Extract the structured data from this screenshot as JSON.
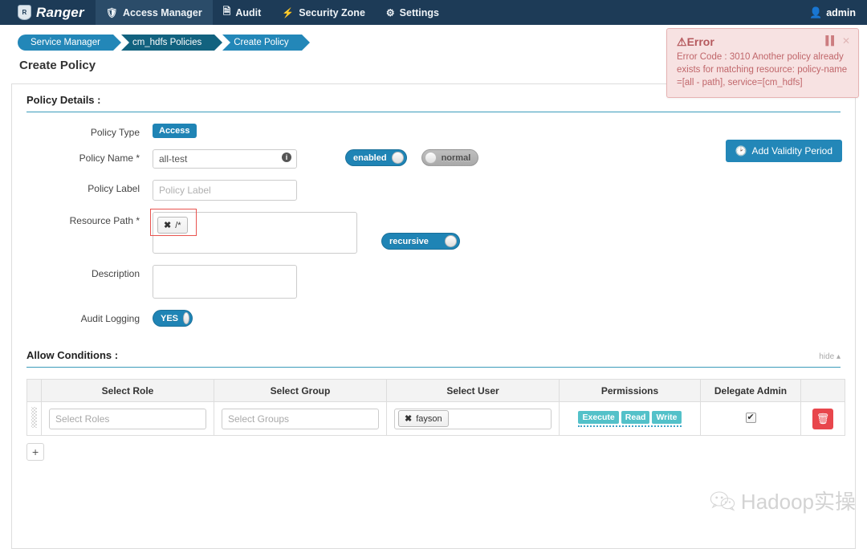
{
  "topnav": {
    "brand": "Ranger",
    "brand_badge": "R",
    "items": [
      {
        "label": "Access Manager",
        "icon": "shield-icon",
        "glyph": "⛨",
        "active": true
      },
      {
        "label": "Audit",
        "icon": "file-icon",
        "glyph": "὜E",
        "active": false
      },
      {
        "label": "Security Zone",
        "icon": "bolt-icon",
        "glyph": "⚡",
        "active": false
      },
      {
        "label": "Settings",
        "icon": "gear-icon",
        "glyph": "⚙",
        "active": false
      }
    ],
    "user": "admin",
    "user_icon": "user-icon"
  },
  "breadcrumb": [
    {
      "label": "Service Manager",
      "active": false
    },
    {
      "label": "cm_hdfs Policies",
      "active": true
    },
    {
      "label": "Create Policy",
      "active": false
    }
  ],
  "page_title": "Create Policy",
  "toast": {
    "title": "Error",
    "warn_icon": "warning-icon",
    "pause_icon": "pause-icon",
    "close_icon": "close-icon",
    "message": "Error Code : 3010 Another policy already exists for matching resource: policy-name =[all - path], service=[cm_hdfs]"
  },
  "policy_details": {
    "section_title": "Policy Details :",
    "add_validity_label": "Add Validity Period",
    "add_validity_icon": "clock-icon",
    "fields": {
      "policy_type_label": "Policy Type",
      "policy_type_value": "Access",
      "policy_name_label": "Policy Name *",
      "policy_name_value": "all-test",
      "policy_name_info_icon": "info-icon",
      "enabled_toggle": "enabled",
      "normal_toggle": "normal",
      "policy_label_label": "Policy Label",
      "policy_label_placeholder": "Policy Label",
      "policy_label_value": "",
      "resource_path_label": "Resource Path *",
      "resource_path_chip": "/*",
      "resource_path_chip_remove": "✖",
      "recursive_toggle": "recursive",
      "description_label": "Description",
      "description_value": "",
      "audit_logging_label": "Audit Logging",
      "audit_logging_toggle": "YES"
    }
  },
  "allow_conditions": {
    "section_title": "Allow Conditions :",
    "hide_label": "hide",
    "hide_caret": "▴",
    "columns": [
      "Select Role",
      "Select Group",
      "Select User",
      "Permissions",
      "Delegate Admin"
    ],
    "rows": [
      {
        "role_placeholder": "Select Roles",
        "role_value": "",
        "group_placeholder": "Select Groups",
        "group_value": "",
        "user_chip": "fayson",
        "user_chip_remove": "✖",
        "permissions": [
          "Execute",
          "Read",
          "Write"
        ],
        "delegate_admin_checked": true,
        "delete_icon": "delete-icon"
      }
    ],
    "add_row_label": "+"
  },
  "watermark": {
    "text": "Hadoop实操",
    "logo": "wechat-icon"
  },
  "colors": {
    "navbar": "#1d3b57",
    "accent": "#2387b8",
    "crumb_active": "#12627f",
    "error_text": "#c0666a",
    "error_bg": "#f7e2e2",
    "permission_badge": "#53c1c9",
    "delete_button": "#e8464c",
    "highlight_outline": "#e8534f"
  }
}
